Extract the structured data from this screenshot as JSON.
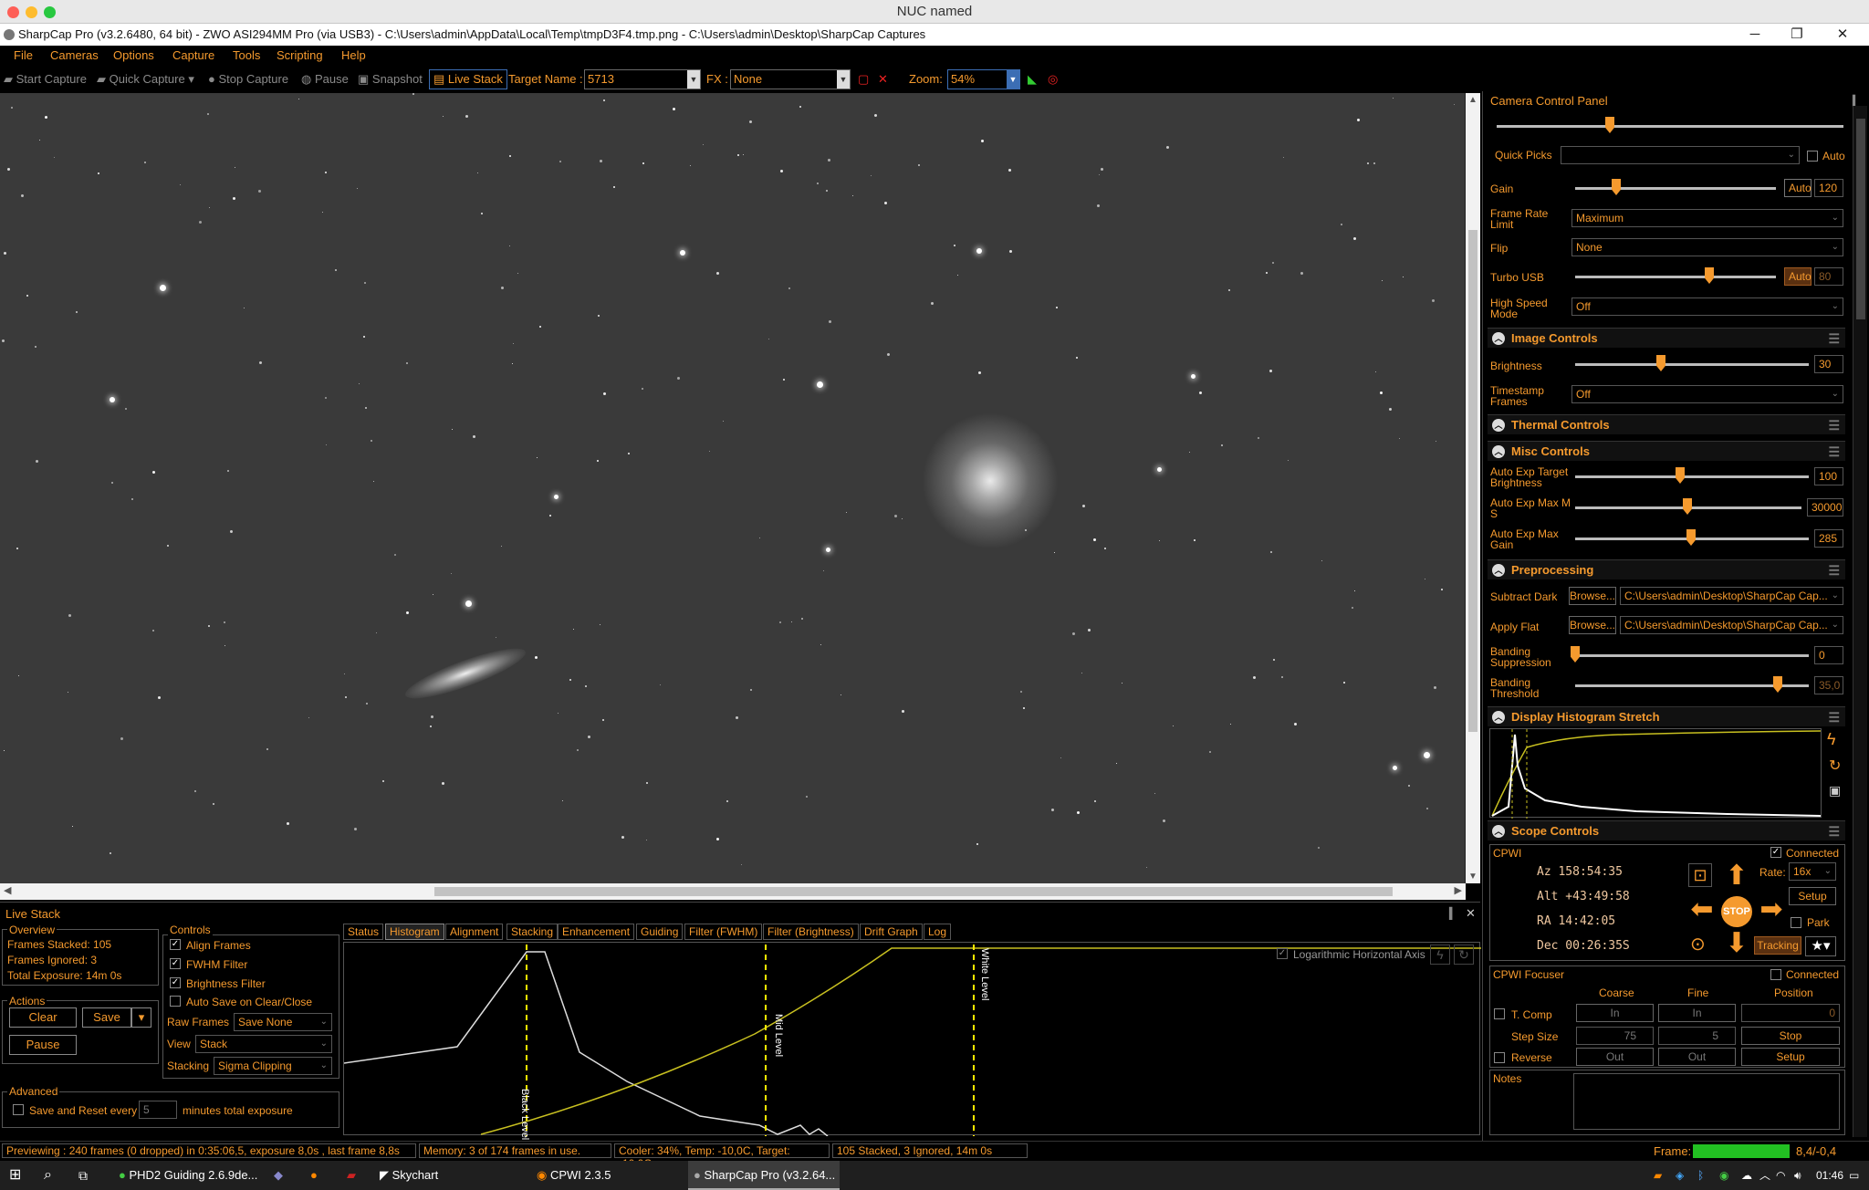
{
  "mac_title": "NUC named",
  "window_title": "SharpCap Pro (v3.2.6480, 64 bit) - ZWO ASI294MM Pro (via USB3) - C:\\Users\\admin\\AppData\\Local\\Temp\\tmpD3F4.tmp.png - C:\\Users\\admin\\Desktop\\SharpCap Captures",
  "menu": [
    "File",
    "Cameras",
    "Options",
    "Capture",
    "Tools",
    "Scripting",
    "Help"
  ],
  "toolbar": {
    "start_capture": "Start Capture",
    "quick_capture": "Quick Capture",
    "stop_capture": "Stop Capture",
    "pause": "Pause",
    "snapshot": "Snapshot",
    "live_stack": "Live Stack",
    "target_label": "Target Name :",
    "target_value": "5713",
    "fx_label": "FX :",
    "fx_value": "None",
    "zoom_label": "Zoom:",
    "zoom_value": "54%"
  },
  "panel": {
    "title": "Camera Control Panel",
    "quick_picks": "Quick Picks",
    "auto": "Auto",
    "gain": {
      "label": "Gain",
      "auto": "Auto",
      "value": "120"
    },
    "frame_rate": {
      "label": "Frame Rate Limit",
      "value": "Maximum"
    },
    "flip": {
      "label": "Flip",
      "value": "None"
    },
    "turbo": {
      "label": "Turbo USB",
      "auto": "Auto",
      "value": "80"
    },
    "hsm": {
      "label": "High Speed Mode",
      "value": "Off"
    },
    "image_controls": "Image Controls",
    "brightness": {
      "label": "Brightness",
      "value": "30"
    },
    "timestamp": {
      "label": "Timestamp Frames",
      "value": "Off"
    },
    "thermal": "Thermal Controls",
    "misc": "Misc Controls",
    "aet": {
      "label": "Auto Exp Target Brightness",
      "value": "100"
    },
    "aem": {
      "label": "Auto Exp Max M S",
      "value": "30000"
    },
    "aeg": {
      "label": "Auto Exp Max Gain",
      "value": "285"
    },
    "preprocessing": "Preprocessing",
    "sub_dark": {
      "label": "Subtract Dark",
      "browse": "Browse...",
      "path": "C:\\Users\\admin\\Desktop\\SharpCap Cap..."
    },
    "apply_flat": {
      "label": "Apply Flat",
      "browse": "Browse...",
      "path": "C:\\Users\\admin\\Desktop\\SharpCap Cap..."
    },
    "band_sup": {
      "label": "Banding Suppression",
      "value": "0"
    },
    "band_thr": {
      "label": "Banding Threshold",
      "value": "35,0"
    },
    "histo": "Display Histogram Stretch",
    "scope": "Scope Controls",
    "cpwi": "CPWI",
    "connected": "Connected",
    "az": "Az   158:54:35",
    "alt": "Alt  +43:49:58",
    "ra": "RA   14:42:05",
    "dec": "Dec  00:26:35S",
    "rate_label": "Rate:",
    "rate_value": "16x",
    "setup": "Setup",
    "park": "Park",
    "stop": "STOP",
    "tracking": "Tracking",
    "focuser": "CPWI Focuser",
    "f_connected": "Connected",
    "coarse": "Coarse",
    "fine": "Fine",
    "position": "Position",
    "tcomp": "T. Comp",
    "in": "In",
    "in2": "In",
    "pos_value": "0",
    "step_size": "Step Size",
    "coarse_step": "75",
    "fine_step": "5",
    "stop_btn": "Stop",
    "reverse": "Reverse",
    "out": "Out",
    "out2": "Out",
    "setup2": "Setup",
    "notes": "Notes"
  },
  "livestack": {
    "title": "Live Stack",
    "overview": "Overview",
    "stacked": "Frames Stacked:  105",
    "ignored": "Frames Ignored:   3",
    "exposure": "Total Exposure:    14m 0s",
    "actions": "Actions",
    "clear": "Clear",
    "save": "Save",
    "pause": "Pause",
    "advanced": "Advanced",
    "save_reset": "Save and Reset every",
    "minutes_val": "5",
    "minutes": "minutes total exposure",
    "controls": "Controls",
    "align": "Align Frames",
    "fwhm": "FWHM Filter",
    "bright": "Brightness Filter",
    "autosave": "Auto Save on Clear/Close",
    "raw_frames": "Raw Frames",
    "raw_value": "Save None",
    "view": "View",
    "view_value": "Stack",
    "stacking": "Stacking",
    "stacking_value": "Sigma Clipping",
    "tabs": [
      "Status",
      "Histogram",
      "Alignment",
      "Stacking",
      "Enhancement",
      "Guiding",
      "Filter (FWHM)",
      "Filter (Brightness)",
      "Drift Graph",
      "Log"
    ],
    "log_axis": "Logarithmic Horizontal Axis",
    "black": "Black Level",
    "mid": "Mid Level",
    "white": "White Level"
  },
  "status": {
    "preview": "Previewing : 240 frames (0 dropped) in 0:35:06,5, exposure 8,0s , last frame 8,8s",
    "memory": "Memory: 3 of 174 frames in use.",
    "cooler": "Cooler: 34%, Temp: -10,0C, Target: -10,0C",
    "stacked": "105 Stacked, 3 Ignored, 14m 0s",
    "frame_label": "Frame:",
    "frame_value": "8,4/-0,4"
  },
  "taskbar": {
    "phd": "PHD2 Guiding 2.6.9de...",
    "skychart": "Skychart",
    "cpwi": "CPWI 2.3.5",
    "sharpcap": "SharpCap Pro (v3.2.64...",
    "time": "01:46"
  },
  "colors": {
    "accent": "#f59a2e",
    "bg": "#000000",
    "frame_bar": "#22c022"
  }
}
